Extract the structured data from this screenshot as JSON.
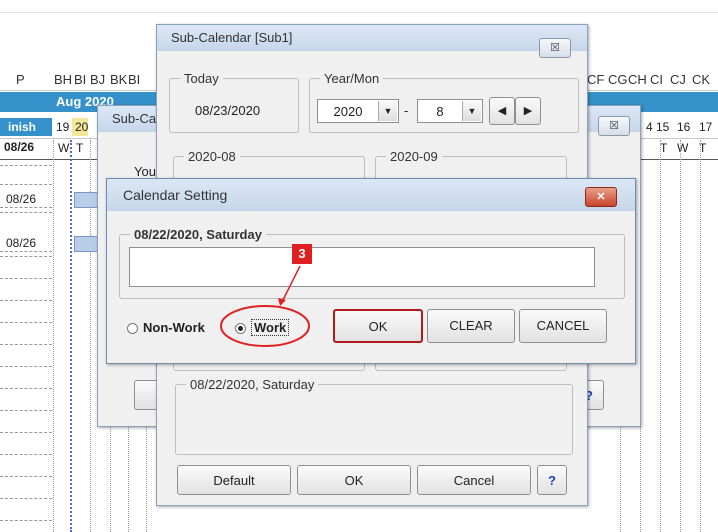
{
  "sheet": {
    "col_headers": [
      "P",
      "BH",
      "BI",
      "BJ",
      "BK",
      "BI"
    ],
    "col_headers_right": [
      "CF",
      "CG",
      "CH",
      "CI",
      "CJ",
      "CK"
    ],
    "month": "Aug 2020",
    "finish_label": "inish",
    "day_nums": [
      "19",
      "20"
    ],
    "day_nums_right": [
      "4",
      "15",
      "16",
      "17"
    ],
    "finish_value": "08/26",
    "weekday": [
      "W",
      "T"
    ],
    "weekday_right": [
      "T",
      "W",
      "T"
    ],
    "rows": [
      "08/26",
      "08/26"
    ]
  },
  "sub_calendar": {
    "title": "Sub-Calendar [Sub1]",
    "close": "☒",
    "today_group": "Today",
    "today_value": "08/23/2020",
    "yearmon_group": "Year/Mon",
    "year": "2020",
    "separator": "-",
    "month": "8",
    "prev": "◀",
    "next": "▶",
    "month1": "2020-08",
    "month2": "2020-09",
    "date_group": "08/22/2020, Saturday",
    "default_btn": "Default",
    "ok_btn": "OK",
    "cancel_btn": "Cancel",
    "help_btn": "?"
  },
  "sub_calendar_back": {
    "title": "Sub-Ca",
    "close": "☒",
    "text": "You",
    "help_btn": "?"
  },
  "calendar_setting": {
    "title": "Calendar Setting",
    "close": "✕",
    "group_label": "08/22/2020, Saturday",
    "memo_value": "",
    "non_work": "Non-Work",
    "work": "Work",
    "ok_btn": "OK",
    "clear_btn": "CLEAR",
    "cancel_btn": "CANCEL",
    "selected": "Work"
  },
  "annotation": {
    "step": "3"
  },
  "colors": {
    "header_blue": "#3591c9",
    "callout_red": "#e02020",
    "title_gradient": "#c6d6ea"
  }
}
